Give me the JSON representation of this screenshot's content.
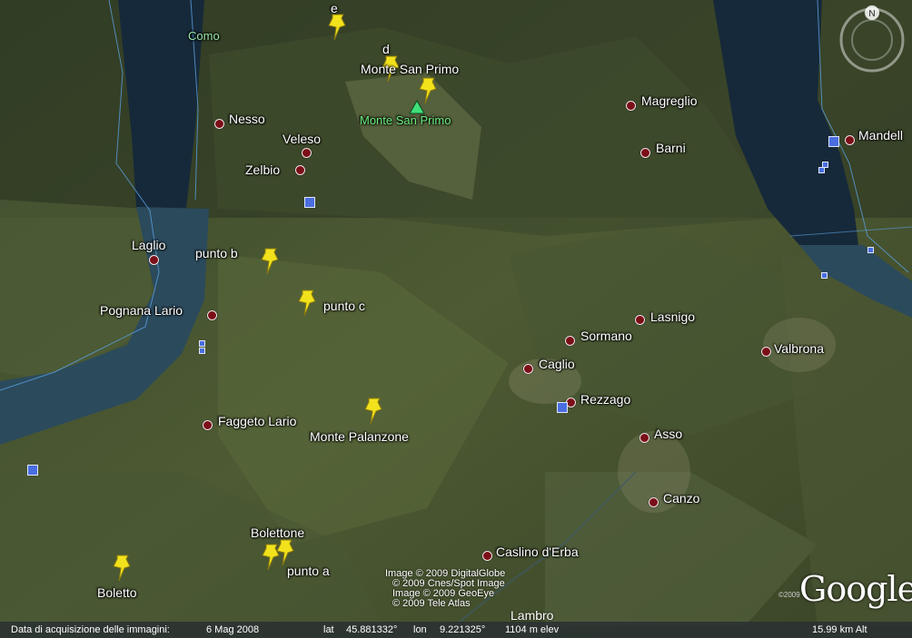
{
  "labels": {
    "como": "Como",
    "e": "e",
    "d": "d",
    "monte_san_primo": "Monte San Primo",
    "monte_san_primo_peak": "Monte San Primo",
    "nesso": "Nesso",
    "veleso": "Veleso",
    "zelbio": "Zelbio",
    "magreglio": "Magreglio",
    "barni": "Barni",
    "mandello": "Mandell",
    "laglio": "Laglio",
    "punto_b": "punto b",
    "punto_c": "punto c",
    "pognana_lario": "Pognana Lario",
    "lasnigo": "Lasnigo",
    "sormano": "Sormano",
    "valbrona": "Valbrona",
    "caglio": "Caglio",
    "rezzago": "Rezzago",
    "faggeto_lario": "Faggeto Lario",
    "monte_palanzone": "Monte Palanzone",
    "asso": "Asso",
    "canzo": "Canzo",
    "bolettone": "Bolettone",
    "caslino_derba": "Caslino d'Erba",
    "punto_a": "punto a",
    "boletto": "Boletto",
    "lambro": "Lambro"
  },
  "credits": [
    "Image © 2009 DigitalGlobe",
    "© 2009 Cnes/Spot Image",
    "Image © 2009 GeoEye",
    "© 2009 Tele Atlas"
  ],
  "logo": {
    "google": "Google",
    "year": "©2009"
  },
  "status": {
    "date_label": "Data di acquisizione delle immagini:",
    "date_value": "6 Mag 2008",
    "lat_label": "lat",
    "lat_value": "45.881332°",
    "lon_label": "lon",
    "lon_value": "9.221325°",
    "elev": "1104 m elev",
    "alt": "15.99 km Alt"
  },
  "compass": {
    "north": "N"
  },
  "colors": {
    "pin": "#f2e21c",
    "place_dot": "#7a0f18",
    "water": "#1f3a4f",
    "peak_label": "#6bf07a"
  }
}
